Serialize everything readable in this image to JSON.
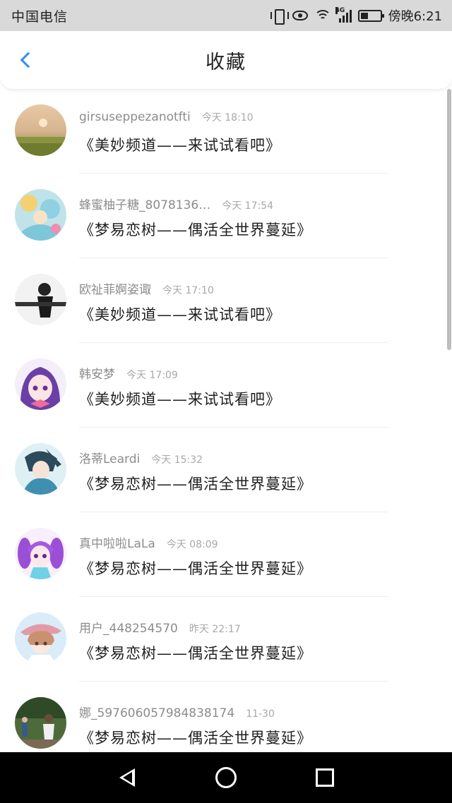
{
  "status_bar": {
    "carrier": "中国电信",
    "lte": "4G",
    "clock": "傍晚6:21"
  },
  "header": {
    "title": "收藏"
  },
  "favorites": [
    {
      "username": "girsuseppezanotfti",
      "time": "今天 18:10",
      "message": "《美妙频道——来试试看吧》",
      "avatar": "avatar-sunset-field"
    },
    {
      "username": "蜂蜜柚子糖_8078136…",
      "time": "今天 17:54",
      "message": "《梦易恋树——偶活全世界蔓延》",
      "avatar": "avatar-alice-illustration"
    },
    {
      "username": "欧祉菲婀姿诹",
      "time": "今天 17:10",
      "message": "《美妙频道——来试试看吧》",
      "avatar": "avatar-bw-figure"
    },
    {
      "username": "韩安梦",
      "time": "今天 17:09",
      "message": "《美妙频道——来试试看吧》",
      "avatar": "avatar-purple-anime-girl"
    },
    {
      "username": "洛蒂Leardi",
      "time": "今天 15:32",
      "message": "《梦易恋树——偶活全世界蔓延》",
      "avatar": "avatar-blue-anime-boy"
    },
    {
      "username": "真中啦啦LaLa",
      "time": "今天 08:09",
      "message": "《梦易恋树——偶活全世界蔓延》",
      "avatar": "avatar-purple-twin-tail-girl"
    },
    {
      "username": "用户_448254570",
      "time": "昨天 22:17",
      "message": "《梦易恋树——偶活全世界蔓延》",
      "avatar": "avatar-pink-hat-girl"
    },
    {
      "username": "娜_597606057984838174",
      "time": "11-30",
      "message": "《梦易恋树——偶活全世界蔓延》",
      "avatar": "avatar-child-outdoors"
    }
  ],
  "colors": {
    "accent": "#2f8ff3",
    "status_bar_bg": "#d9d9d9",
    "nav_bar_bg": "#000000"
  }
}
